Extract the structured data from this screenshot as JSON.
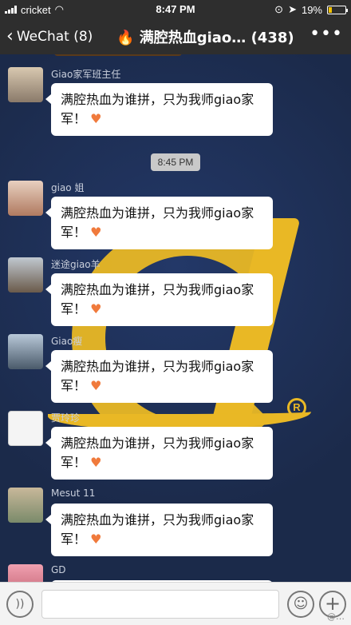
{
  "status_bar": {
    "carrier": "cricket",
    "time": "8:47 PM",
    "battery_percent": "19%",
    "battery_level": 0.19
  },
  "nav": {
    "back_label": "WeChat (8)",
    "title": "满腔热血giao…",
    "member_count": "(438)",
    "fire_emoji": "🔥"
  },
  "chat": {
    "timestamp": "8:45 PM",
    "messages": [
      {
        "sender": "Giao家军班主任",
        "text": "满腔热血为谁拼，只为我师giao家军！",
        "heart": "♥"
      },
      {
        "sender": "giao 姐",
        "text": "满腔热血为谁拼，只为我师giao家军！",
        "heart": "♥"
      },
      {
        "sender": "迷途giao羊",
        "text": "满腔热血为谁拼，只为我师giao家军！",
        "heart": "♥"
      },
      {
        "sender": "Giao瘦",
        "text": "满腔热血为谁拼，只为我师giao家军！",
        "heart": "♥"
      },
      {
        "sender": "贾玲珍",
        "text": "满腔热血为谁拼，只为我师giao家军！",
        "heart": "♥"
      },
      {
        "sender": "Mesut 11",
        "text": "满腔热血为谁拼，只为我师giao家军！",
        "heart": "♥"
      },
      {
        "sender": "GD",
        "text": "",
        "heart": ""
      }
    ]
  },
  "input_bar": {
    "voice_icon": "voice-icon",
    "emoji_icon": "emoji-icon",
    "plus_icon": "plus-icon",
    "watermark": "@…"
  },
  "colors": {
    "bubble": "#ffffff",
    "background": "#1b2a4a",
    "logo": "#e9b825",
    "heart": "#f07a3c"
  }
}
